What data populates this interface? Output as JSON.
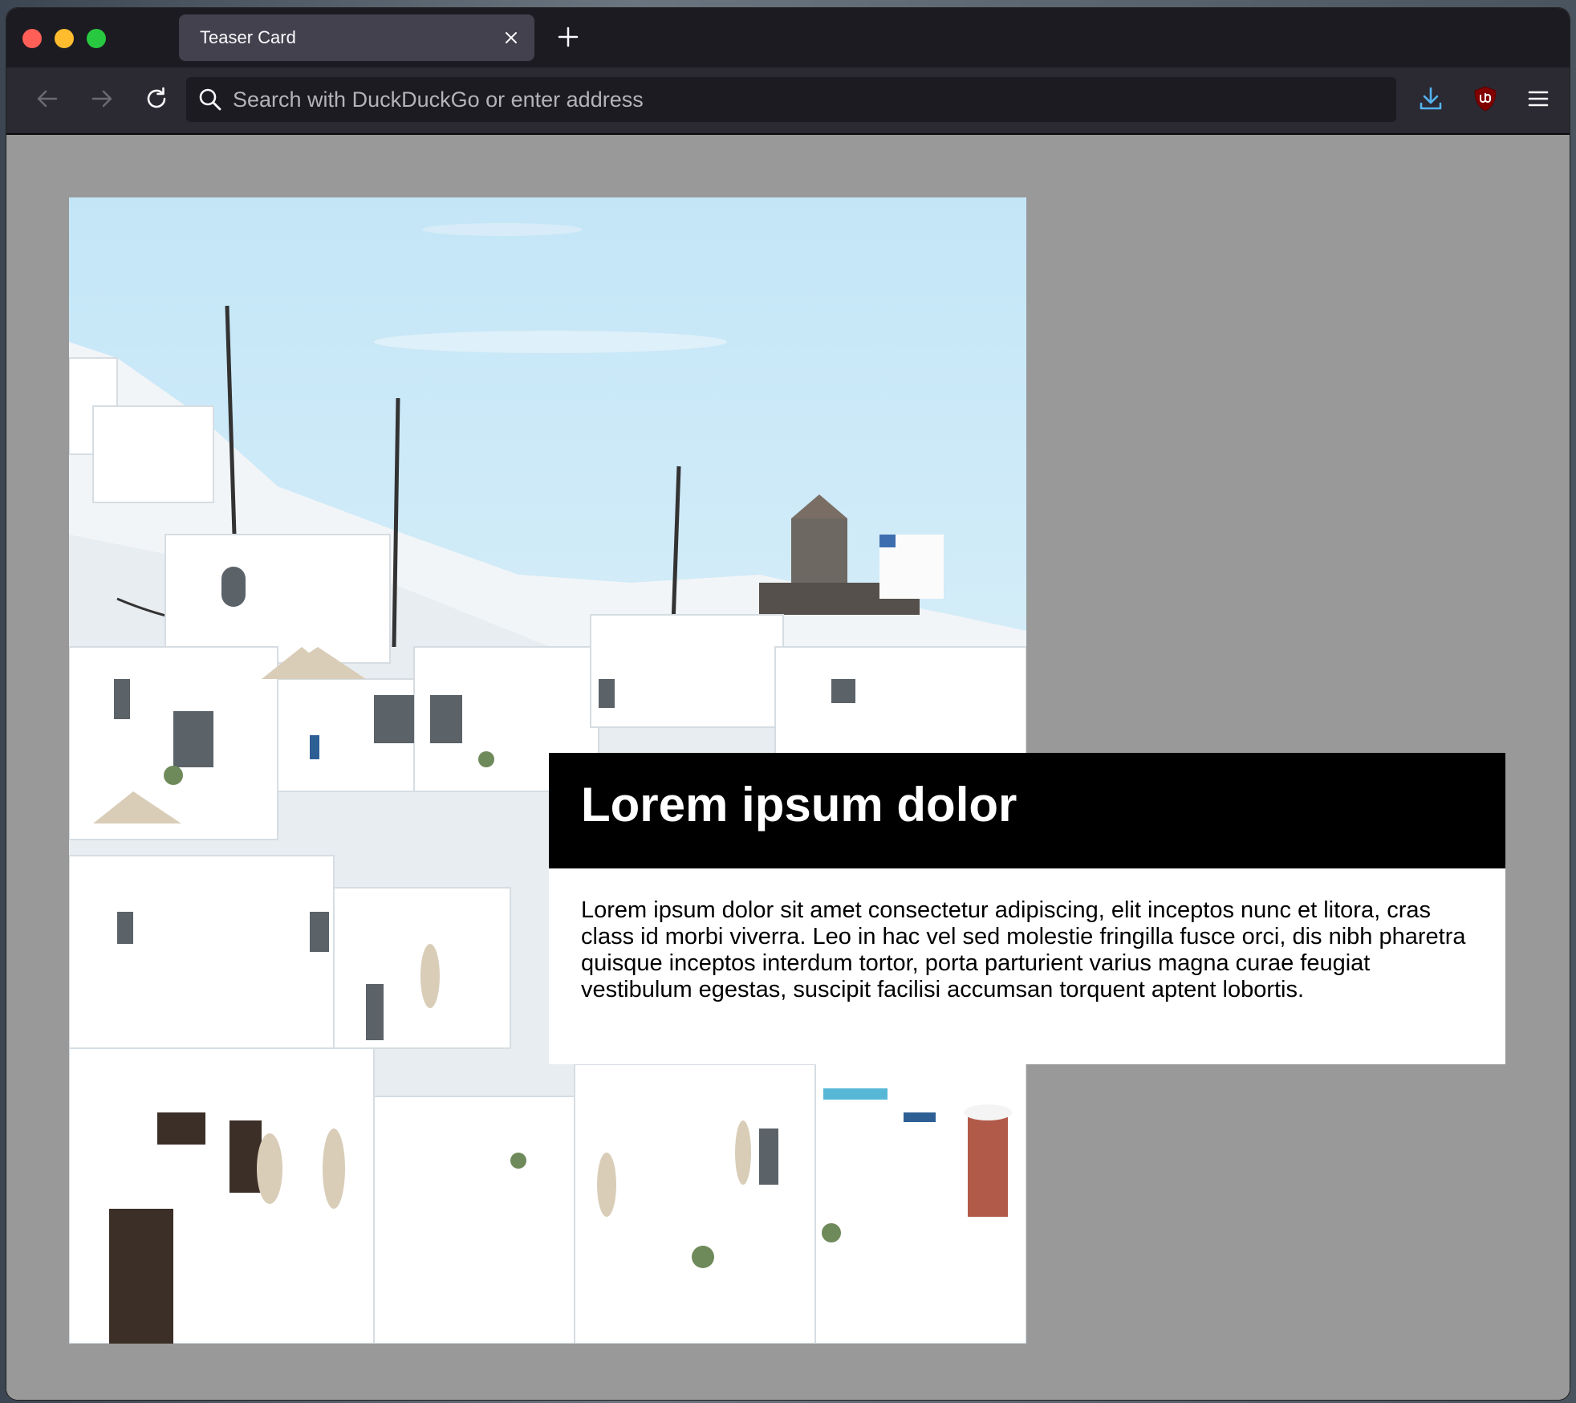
{
  "browser": {
    "tab": {
      "title": "Teaser Card",
      "close_icon": "close-icon"
    },
    "new_tab_icon": "plus-icon",
    "nav": {
      "back_icon": "arrow-left-icon",
      "forward_icon": "arrow-right-icon",
      "reload_icon": "reload-icon"
    },
    "urlbar": {
      "placeholder": "Search with DuckDuckGo or enter address",
      "search_icon": "search-icon"
    },
    "toolbar": {
      "download_icon": "download-icon",
      "extension_icon": "ublock-shield-icon",
      "menu_icon": "hamburger-menu-icon"
    },
    "colors": {
      "tabbar_bg": "#1c1b22",
      "navbar_bg": "#2b2a33",
      "accent_download": "#54b3ee",
      "close_red": "#ff5f57",
      "minimize_yellow": "#febc2e",
      "zoom_green": "#28c840"
    }
  },
  "page": {
    "background": "#999999",
    "card": {
      "title": "Lorem ipsum dolor",
      "body": "Lorem ipsum dolor sit amet consectetur adipiscing, elit inceptos nunc et litora, cras class id morbi viverra. Leo in hac vel sed molestie fringilla fusce orci, dis nibh pharetra quisque inceptos interdum tortor, porta parturient varius magna curae feugiat vestibulum egestas, suscipit facilisi accumsan torquent aptent lobortis."
    }
  }
}
